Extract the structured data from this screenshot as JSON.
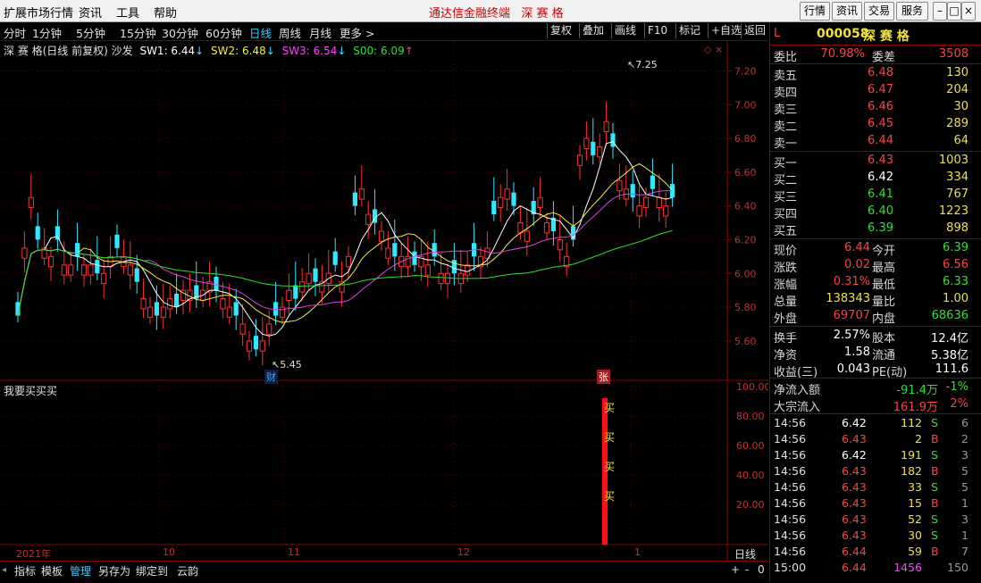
{
  "menu": {
    "items": [
      "扩展市场行情",
      "资讯",
      "工具",
      "帮助"
    ],
    "title": "通达信金融终端",
    "title_stock": "深 赛 格",
    "right_buttons": [
      "行情",
      "资讯",
      "交易",
      "服务"
    ]
  },
  "toolbar": {
    "periods": [
      "分时",
      "1分钟",
      "5分钟",
      "15分钟",
      "30分钟",
      "60分钟",
      "日线",
      "周线",
      "月线",
      "更多 >"
    ],
    "active_period": "日线",
    "right_buttons": [
      "复权",
      "叠加",
      "画线",
      "F10",
      "标记",
      "+自选",
      "返回"
    ]
  },
  "main_chart": {
    "header_name": "深 赛 格(日线 前复权) 沙发",
    "indicators": [
      {
        "label": "SW1: 6.44",
        "arrow": "↓",
        "color": "#ffffff"
      },
      {
        "label": "SW2: 6.48",
        "arrow": "↓",
        "color": "#f0f040"
      },
      {
        "label": "SW3: 6.54",
        "arrow": "↓",
        "color": "#ff40ff"
      },
      {
        "label": "S00: 6.09",
        "arrow": "↑",
        "color": "#30e030"
      }
    ],
    "y_ticks": [
      "7.20",
      "7.00",
      "6.80",
      "6.60",
      "6.40",
      "6.20",
      "6.00",
      "5.80",
      "5.60"
    ],
    "high_label": "7.25",
    "low_label": "5.45",
    "marker_cai": "财",
    "marker_zhang": "张"
  },
  "sub_chart": {
    "title": "我要买买买",
    "y_ticks": [
      "100.00",
      "80.00",
      "60.00",
      "40.00",
      "20.00"
    ],
    "buy_labels": [
      "买",
      "买",
      "买",
      "买"
    ]
  },
  "time_axis": {
    "labels": [
      "2021年",
      "10",
      "11",
      "12",
      "1"
    ],
    "period": "日线"
  },
  "bottom_bar": {
    "tabs": [
      "指标",
      "模板",
      "管理",
      "另存为",
      "绑定到",
      "云韵"
    ],
    "active": "管理",
    "right_controls": [
      "+",
      "-",
      "0"
    ]
  },
  "quote": {
    "code_prefix": "L",
    "code": "000058",
    "name": "深 赛 格",
    "weibi_label": "委比",
    "weibi": "70.98%",
    "weicha_label": "委差",
    "weicha": "3508",
    "asks": [
      {
        "label": "卖五",
        "price": "6.48",
        "vol": "130"
      },
      {
        "label": "卖四",
        "price": "6.47",
        "vol": "204"
      },
      {
        "label": "卖三",
        "price": "6.46",
        "vol": "30"
      },
      {
        "label": "卖二",
        "price": "6.45",
        "vol": "289"
      },
      {
        "label": "卖一",
        "price": "6.44",
        "vol": "64"
      }
    ],
    "bids": [
      {
        "label": "买一",
        "price": "6.43",
        "vol": "1003",
        "pc": "red"
      },
      {
        "label": "买二",
        "price": "6.42",
        "vol": "334",
        "pc": "white"
      },
      {
        "label": "买三",
        "price": "6.41",
        "vol": "767",
        "pc": "green"
      },
      {
        "label": "买四",
        "price": "6.40",
        "vol": "1223",
        "pc": "green"
      },
      {
        "label": "买五",
        "price": "6.39",
        "vol": "898",
        "pc": "green"
      }
    ],
    "stats": [
      {
        "l1": "现价",
        "v1": "6.44",
        "c1": "red",
        "l2": "今开",
        "v2": "6.39",
        "c2": "green"
      },
      {
        "l1": "涨跌",
        "v1": "0.02",
        "c1": "red",
        "l2": "最高",
        "v2": "6.56",
        "c2": "red"
      },
      {
        "l1": "涨幅",
        "v1": "0.31%",
        "c1": "red",
        "l2": "最低",
        "v2": "6.33",
        "c2": "green"
      },
      {
        "l1": "总量",
        "v1": "138343",
        "c1": "yellow",
        "l2": "量比",
        "v2": "1.00",
        "c2": "yellow"
      },
      {
        "l1": "外盘",
        "v1": "69707",
        "c1": "red",
        "l2": "内盘",
        "v2": "68636",
        "c2": "green"
      }
    ],
    "stats2": [
      {
        "l1": "换手",
        "v1": "2.57%",
        "l2": "股本",
        "v2": "12.4亿"
      },
      {
        "l1": "净资",
        "v1": "1.58",
        "l2": "流通",
        "v2": "5.38亿"
      },
      {
        "l1": "收益(三)",
        "v1": "0.043",
        "l2": "PE(动)",
        "v2": "111.6"
      }
    ],
    "flow": [
      {
        "label": "净流入额",
        "value": "-91.4万",
        "pct": "-1%",
        "c": "green"
      },
      {
        "label": "大宗流入",
        "value": "161.9万",
        "pct": "2%",
        "c": "red"
      }
    ],
    "ticks": [
      {
        "t": "14:56",
        "p": "6.42",
        "pc": "white",
        "v": "112",
        "s": "S",
        "n": "6"
      },
      {
        "t": "14:56",
        "p": "6.43",
        "pc": "red",
        "v": "2",
        "s": "B",
        "n": "2"
      },
      {
        "t": "14:56",
        "p": "6.42",
        "pc": "white",
        "v": "191",
        "s": "S",
        "n": "3"
      },
      {
        "t": "14:56",
        "p": "6.43",
        "pc": "red",
        "v": "182",
        "s": "B",
        "n": "5"
      },
      {
        "t": "14:56",
        "p": "6.43",
        "pc": "red",
        "v": "33",
        "s": "S",
        "n": "5"
      },
      {
        "t": "14:56",
        "p": "6.43",
        "pc": "red",
        "v": "15",
        "s": "B",
        "n": "1"
      },
      {
        "t": "14:56",
        "p": "6.43",
        "pc": "red",
        "v": "52",
        "s": "S",
        "n": "3"
      },
      {
        "t": "14:56",
        "p": "6.43",
        "pc": "red",
        "v": "30",
        "s": "S",
        "n": "1"
      },
      {
        "t": "14:56",
        "p": "6.44",
        "pc": "red",
        "v": "59",
        "s": "B",
        "n": "7"
      },
      {
        "t": "15:00",
        "p": "6.44",
        "pc": "red",
        "v": "1456",
        "s": "",
        "n": "150"
      }
    ]
  },
  "colors": {
    "up": "#ff3030",
    "down": "#30e8ff",
    "sw1": "#ffffff",
    "sw2": "#f0f040",
    "sw3": "#e040e0",
    "s00": "#30e030",
    "buy_bar": "#ff1010"
  }
}
